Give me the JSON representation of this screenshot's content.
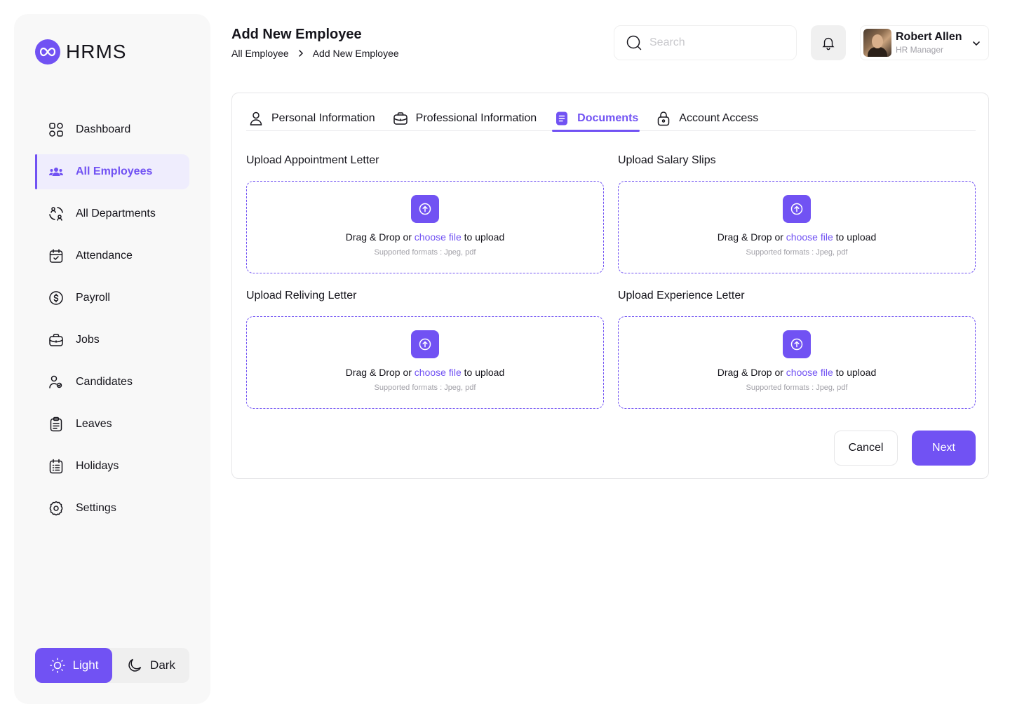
{
  "brand": {
    "name": "HRMS",
    "logo_icon": "infinity-icon"
  },
  "colors": {
    "accent": "#7152f3",
    "accent_light": "#efedfd",
    "sidebar_bg": "#f8f8f8",
    "text": "#16151c",
    "muted": "#a2a1a8"
  },
  "sidebar": {
    "items": [
      {
        "label": "Dashboard",
        "icon": "dashboard-grid-icon",
        "active": false
      },
      {
        "label": "All Employees",
        "icon": "users-icon",
        "active": true
      },
      {
        "label": "All Departments",
        "icon": "departments-icon",
        "active": false
      },
      {
        "label": "Attendance",
        "icon": "calendar-check-icon",
        "active": false
      },
      {
        "label": "Payroll",
        "icon": "dollar-circle-icon",
        "active": false
      },
      {
        "label": "Jobs",
        "icon": "briefcase-icon",
        "active": false
      },
      {
        "label": "Candidates",
        "icon": "candidates-icon",
        "active": false
      },
      {
        "label": "Leaves",
        "icon": "clipboard-icon",
        "active": false
      },
      {
        "label": "Holidays",
        "icon": "calendar-list-icon",
        "active": false
      },
      {
        "label": "Settings",
        "icon": "gear-icon",
        "active": false
      }
    ],
    "theme": {
      "light_label": "Light",
      "dark_label": "Dark",
      "selected": "Light"
    }
  },
  "header": {
    "title": "Add New Employee",
    "breadcrumb": [
      "All Employee",
      "Add New Employee"
    ],
    "search_placeholder": "Search",
    "user": {
      "name": "Robert Allen",
      "role": "HR Manager"
    }
  },
  "tabs": [
    {
      "label": "Personal Information",
      "icon": "user-icon",
      "active": false
    },
    {
      "label": "Professional Information",
      "icon": "briefcase-icon",
      "active": false
    },
    {
      "label": "Documents",
      "icon": "document-icon",
      "active": true
    },
    {
      "label": "Account Access",
      "icon": "lock-icon",
      "active": false
    }
  ],
  "uploads": [
    {
      "label": "Upload Appointment Letter",
      "pre": "Drag & Drop or ",
      "link": "choose file",
      "post": " to upload",
      "formats": "Supported formats : Jpeg, pdf"
    },
    {
      "label": "Upload Salary Slips",
      "pre": "Drag & Drop or ",
      "link": "choose file",
      "post": " to upload",
      "formats": "Supported formats : Jpeg, pdf"
    },
    {
      "label": "Upload Reliving Letter",
      "pre": "Drag & Drop or ",
      "link": "choose file",
      "post": " to upload",
      "formats": "Supported formats : Jpeg, pdf"
    },
    {
      "label": "Upload Experience Letter",
      "pre": "Drag & Drop or ",
      "link": "choose file",
      "post": " to upload",
      "formats": "Supported formats : Jpeg, pdf"
    }
  ],
  "actions": {
    "cancel_label": "Cancel",
    "next_label": "Next"
  }
}
